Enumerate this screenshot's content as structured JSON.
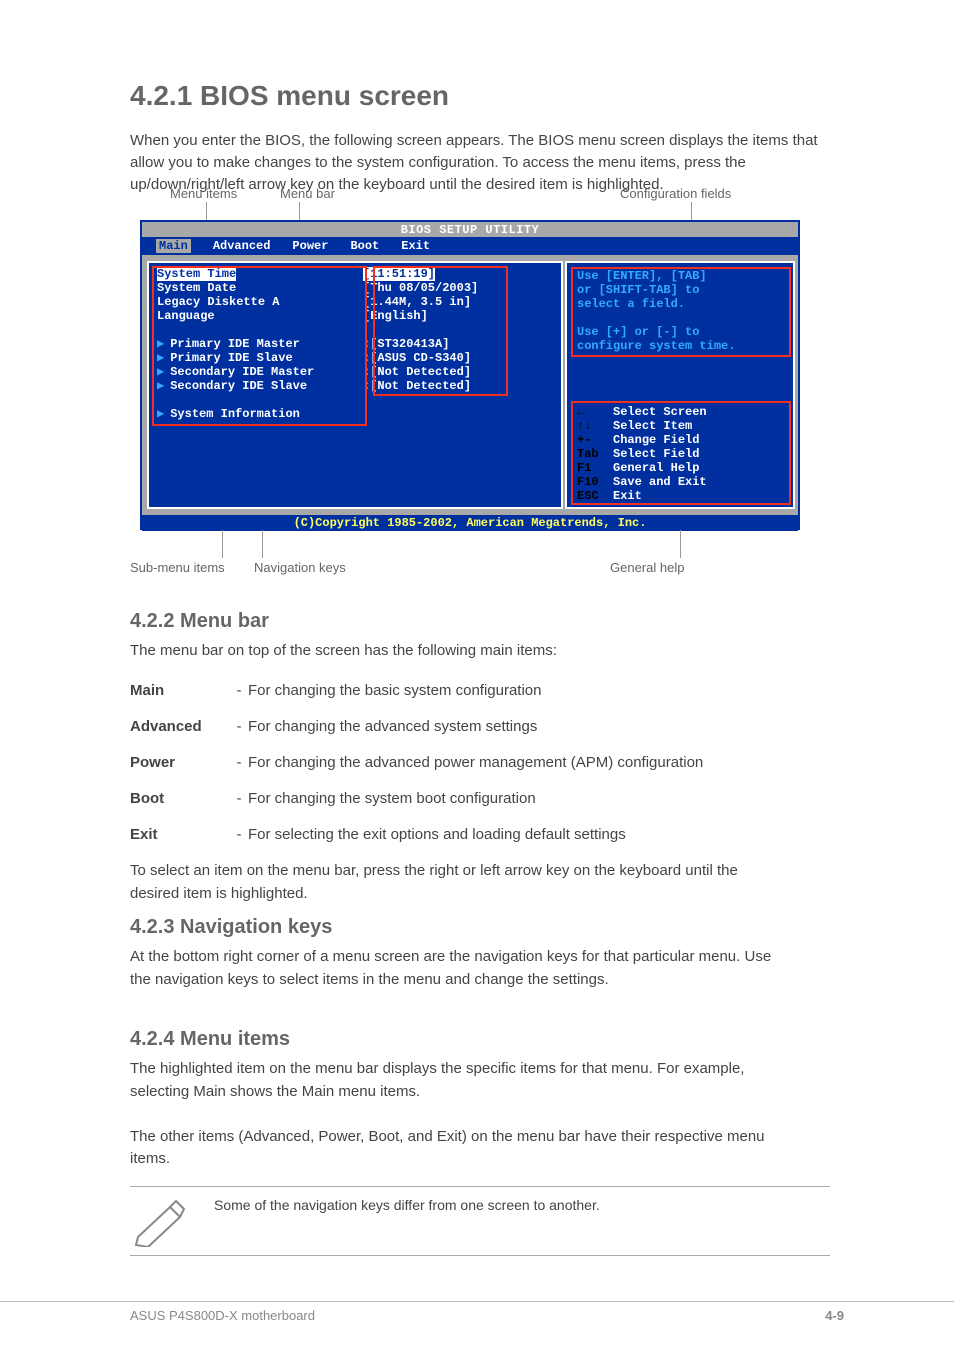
{
  "heading": "4.2.1  BIOS menu screen",
  "intro": "When you enter the BIOS, the following screen appears. The BIOS menu screen displays the items that allow you to make changes to the system configuration. To access the menu items, press the up/down/right/left arrow key on the keyboard until the desired item is highlighted.",
  "callouts": {
    "menu_items": "Menu items",
    "menu_bar": "Menu bar",
    "config": "Configuration fields",
    "submenu": "Sub-menu items",
    "nav": "Navigation keys",
    "help": "General help"
  },
  "bios": {
    "title": "BIOS SETUP UTILITY",
    "tabs": [
      "Main",
      "Advanced",
      "Power",
      "Boot",
      "Exit"
    ],
    "rows": [
      {
        "label": "System Time",
        "value": "[11:51:19]",
        "tri": false,
        "sel": true
      },
      {
        "label": "System Date",
        "value": "[Thu 08/05/2003]",
        "tri": false,
        "sel": false
      },
      {
        "label": "Legacy Diskette A",
        "value": "[1.44M, 3.5 in]",
        "tri": false,
        "sel": false
      },
      {
        "label": "Language",
        "value": "[English]",
        "tri": false,
        "sel": false
      },
      {
        "label": "",
        "value": "",
        "tri": false,
        "sel": false
      },
      {
        "label": "Primary IDE Master",
        "value": ":[ST320413A]",
        "tri": true,
        "sel": false
      },
      {
        "label": "Primary IDE Slave",
        "value": ":[ASUS CD-S340]",
        "tri": true,
        "sel": false
      },
      {
        "label": "Secondary IDE Master",
        "value": ":[Not Detected]",
        "tri": true,
        "sel": false
      },
      {
        "label": "Secondary IDE Slave",
        "value": ":[Not Detected]",
        "tri": true,
        "sel": false
      },
      {
        "label": "",
        "value": "",
        "tri": false,
        "sel": false
      },
      {
        "label": "System Information",
        "value": "",
        "tri": true,
        "sel": false
      }
    ],
    "help": "Use [ENTER], [TAB]\nor [SHIFT-TAB] to\nselect a field.\n\nUse [+] or [-] to\nconfigure system time.",
    "nav": [
      {
        "k": "←",
        "t": "Select Screen"
      },
      {
        "k": "↑↓",
        "t": "Select Item"
      },
      {
        "k": "+-",
        "t": "Change Field"
      },
      {
        "k": "Tab",
        "t": "Select Field"
      },
      {
        "k": "F1",
        "t": "General Help"
      },
      {
        "k": "F10",
        "t": "Save and Exit"
      },
      {
        "k": "ESC",
        "t": "Exit"
      }
    ],
    "copyright": "(C)Copyright 1985-2002, American Megatrends, Inc."
  },
  "menubar": {
    "heading": "4.2.2  Menu bar",
    "intro": "The menu bar on top of the screen has the following main items:",
    "items": [
      {
        "k": "Main",
        "d": "For changing the basic system configuration"
      },
      {
        "k": "Advanced",
        "d": "For changing the advanced system settings"
      },
      {
        "k": "Power",
        "d": "For changing the advanced power management (APM) configuration"
      },
      {
        "k": "Boot",
        "d": "For changing the system boot configuration"
      },
      {
        "k": "Exit",
        "d": "For selecting the exit options and loading default settings"
      }
    ],
    "tail": "To select an item on the menu bar, press the right or left arrow key on the keyboard until the desired item is highlighted."
  },
  "navkeys": {
    "heading": "4.2.3  Navigation keys",
    "text": "At the bottom right corner of a menu screen are the navigation keys for that particular menu. Use the navigation keys to select items in the menu and change the settings."
  },
  "menuitems": {
    "heading": "4.2.4  Menu items",
    "text": "The highlighted item on the menu bar displays the specific items for that menu. For example, selecting Main shows the Main menu items.\n\nThe other items (Advanced, Power, Boot, and Exit) on the menu bar have their respective menu items."
  },
  "note": "Some of the navigation keys differ from one screen to another.",
  "footer": {
    "left": "ASUS P4S800D-X motherboard",
    "right": "4-9"
  }
}
